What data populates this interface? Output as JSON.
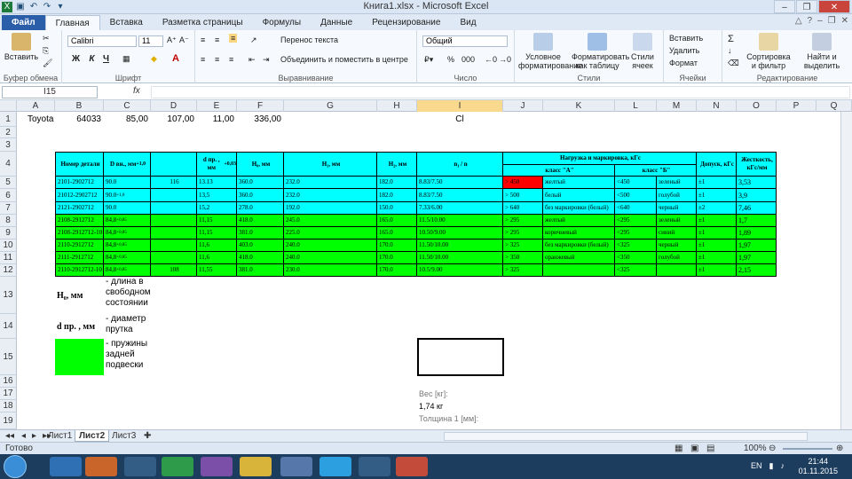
{
  "window": {
    "title": "Книга1.xlsx  -  Microsoft Excel"
  },
  "ribbon_tabs": [
    "Файл",
    "Главная",
    "Вставка",
    "Разметка страницы",
    "Формулы",
    "Данные",
    "Рецензирование",
    "Вид"
  ],
  "ribbon": {
    "paste": "Вставить",
    "clipboard": "Буфер обмена",
    "font_name": "Calibri",
    "font_size": "11",
    "font_group": "Шрифт",
    "bold": "Ж",
    "italic": "К",
    "underline": "Ч",
    "wrap": "Перенос текста",
    "merge": "Объединить и поместить в центре",
    "align_group": "Выравнивание",
    "number_format": "Общий",
    "pct": "%",
    "thousand": "000",
    "number_group": "Число",
    "cond": "Условное форматирование",
    "as_table": "Форматировать как таблицу",
    "cell_styles": "Стили ячеек",
    "styles_group": "Стили",
    "insert": "Вставить",
    "delete": "Удалить",
    "format": "Формат",
    "cells_group": "Ячейки",
    "sigma": "Σ",
    "sort": "Сортировка и фильтр",
    "find": "Найти и выделить",
    "edit_group": "Редактирование"
  },
  "formula_bar": {
    "name_box": "I15",
    "fx": "fx",
    "value": ""
  },
  "columns": [
    "A",
    "B",
    "C",
    "D",
    "E",
    "F",
    "G",
    "H",
    "I",
    "J",
    "K",
    "L",
    "M",
    "N",
    "O",
    "P",
    "Q"
  ],
  "rows": [
    "1",
    "2",
    "3",
    "4",
    "5",
    "6",
    "7",
    "8",
    "9",
    "10",
    "11",
    "12",
    "13",
    "14",
    "15",
    "16",
    "17",
    "18",
    "19"
  ],
  "row1": {
    "a": "Toyota",
    "b": "64033",
    "c": "85,00",
    "d": "107,00",
    "e": "11,00",
    "f": "336,00",
    "i": "Cl"
  },
  "headers": {
    "part": "Номер детали",
    "d_vn": "D вн.,  мм ",
    "d_vn_sup": "+1,0",
    "d_pr": "d пр. , мм ",
    "d_pr_sup": "+0,03",
    "h0": "Н₀, мм",
    "h1": "Н₁, мм",
    "h2": "Н₂, мм",
    "n": "n₁ / n",
    "load": "Нагрузка и маркировка, кГс",
    "class_a": "класс \"А\"",
    "class_b": "класс \"Б\"",
    "tol": "Допуск, кГс",
    "stiff": "Жесткость, кГс/мм"
  },
  "table_rows": [
    {
      "part": "2101-2902712",
      "dvn": "90.0",
      "dvn_sup": "",
      "extra": "116",
      "dpr": "13.13",
      "h0": "360.0",
      "h1": "232.0",
      "h2": "182.0",
      "n": "8.83/7.50",
      "ga": "> 450",
      "ca": "желтый",
      "gb": "<450",
      "cb": "зеленый",
      "tol": "±1",
      "st": "3,53"
    },
    {
      "part": "21012-2902712",
      "dvn": "90.0",
      "dvn_sup": "+1,0",
      "extra": "",
      "dpr": "13,5",
      "h0": "360.0",
      "h1": "232.0",
      "h2": "182.0",
      "n": "8.83/7.50",
      "ga": "> 500",
      "ca": "белый",
      "gb": "<500",
      "cb": "голубой",
      "tol": "±1",
      "st": "3,9"
    },
    {
      "part": "2121-2902712",
      "dvn": "90.0",
      "dvn_sup": "",
      "extra": "",
      "dpr": "15,2",
      "h0": "278.0",
      "h1": "192.0",
      "h2": "150.0",
      "n": "7.33/6.00",
      "ga": "> 640",
      "ca": "без маркировки (белый)",
      "gb": "<640",
      "cb": "черный",
      "tol": "±2",
      "st": "7,46"
    },
    {
      "part": "2108-2912712",
      "dvn": "84,8",
      "dvn_sup": "+0,85",
      "extra": "",
      "dpr": "11,15",
      "h0": "418.0",
      "h1": "245.0",
      "h2": "165.0",
      "n": "11.5/10.00",
      "ga": "> 295",
      "ca": "желтый",
      "gb": "<295",
      "cb": "зеленый",
      "tol": "±1",
      "st": "1,7"
    },
    {
      "part": "2108-2912712-10",
      "dvn": "84,8",
      "dvn_sup": "+0,85",
      "extra": "",
      "dpr": "11,15",
      "h0": "381.0",
      "h1": "225.0",
      "h2": "165.0",
      "n": "10.50/9.00",
      "ga": "> 295",
      "ca": "коричневый",
      "gb": "<295",
      "cb": "синий",
      "tol": "±1",
      "st": "1,89"
    },
    {
      "part": "2110-2912712",
      "dvn": "84,8",
      "dvn_sup": "+0,85",
      "extra": "",
      "dpr": "11,6",
      "h0": "403.0",
      "h1": "240.0",
      "h2": "170.0",
      "n": "11.50/10.00",
      "ga": "> 325",
      "ca": "без маркировки (белый)",
      "gb": "<325",
      "cb": "черный",
      "tol": "±1",
      "st": "1,97"
    },
    {
      "part": "2111-2912712",
      "dvn": "84,8",
      "dvn_sup": "+0,85",
      "extra": "",
      "dpr": "11,6",
      "h0": "418.0",
      "h1": "240.0",
      "h2": "170.0",
      "n": "11.50/10.00",
      "ga": "> 350",
      "ca": "оранжевый",
      "gb": "<350",
      "cb": "голубой",
      "tol": "±1",
      "st": "1,97"
    },
    {
      "part": "2110-2912712-10",
      "dvn": "84,8",
      "dvn_sup": "+0,85",
      "extra": "108",
      "dpr": "11,55",
      "h0": "381.0",
      "h1": "230.0",
      "h2": "170.0",
      "n": "10.5/9.00",
      "ga": "> 325",
      "ca": "",
      "gb": "<325",
      "cb": "",
      "tol": "±1",
      "st": "2,15"
    }
  ],
  "legend": {
    "h0": "Н₀, мм",
    "h0_desc": "- длина в свободном состоянии",
    "dpr": "d пр. , мм",
    "dpr_desc": "- диаметр прутка",
    "green_desc": "- пружины задней подвески"
  },
  "calc": {
    "weight_label": "Вес [кг]:",
    "weight_value": "1,74 кг",
    "thick_label": "Толщина 1 [мм]:"
  },
  "sheets": [
    "Лист1",
    "Лист2",
    "Лист3"
  ],
  "status": {
    "ready": "Готово",
    "zoom": "100%"
  },
  "taskbar": {
    "lang": "EN",
    "time": "21:44",
    "date": "01.11.2015"
  },
  "colors": {
    "cyan": "#00ffff",
    "green": "#00ff00",
    "red": "#ff0000",
    "selected_header": "#f9d98e"
  }
}
